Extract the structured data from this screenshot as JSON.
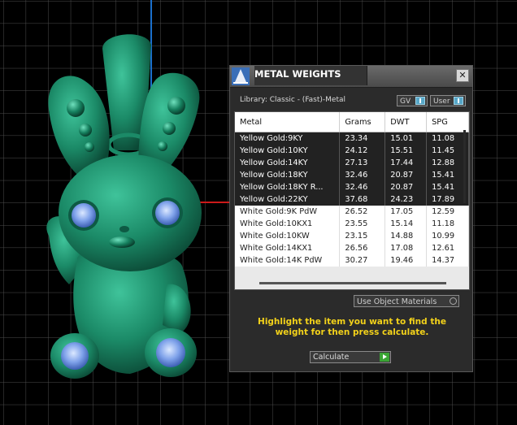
{
  "window": {
    "title": "METAL WEIGHTS",
    "close_glyph": "✕"
  },
  "library": {
    "label": "Library: Classic - (Fast)-Metal"
  },
  "toggles": {
    "gv_label": "GV",
    "user_label": "User"
  },
  "table": {
    "headers": [
      "Metal",
      "Grams",
      "DWT",
      "SPG"
    ],
    "rows": [
      {
        "metal": "Yellow Gold:9KY",
        "grams": "23.34",
        "dwt": "15.01",
        "spg": "11.08"
      },
      {
        "metal": "Yellow Gold:10KY",
        "grams": "24.12",
        "dwt": "15.51",
        "spg": "11.45"
      },
      {
        "metal": "Yellow Gold:14KY",
        "grams": "27.13",
        "dwt": "17.44",
        "spg": "12.88"
      },
      {
        "metal": "Yellow Gold:18KY",
        "grams": "32.46",
        "dwt": "20.87",
        "spg": "15.41"
      },
      {
        "metal": "Yellow Gold:18KY R...",
        "grams": "32.46",
        "dwt": "20.87",
        "spg": "15.41"
      },
      {
        "metal": "Yellow Gold:22KY",
        "grams": "37.68",
        "dwt": "24.23",
        "spg": "17.89"
      },
      {
        "metal": "White Gold:9K PdW",
        "grams": "26.52",
        "dwt": "17.05",
        "spg": "12.59"
      },
      {
        "metal": "White Gold:10KX1",
        "grams": "23.55",
        "dwt": "15.14",
        "spg": "11.18"
      },
      {
        "metal": "White Gold:10KW",
        "grams": "23.15",
        "dwt": "14.88",
        "spg": "10.99"
      },
      {
        "metal": "White Gold:14KX1",
        "grams": "26.56",
        "dwt": "17.08",
        "spg": "12.61"
      },
      {
        "metal": "White Gold:14K PdW",
        "grams": "30.27",
        "dwt": "19.46",
        "spg": "14.37"
      }
    ],
    "selected_rows": [
      0,
      1,
      2,
      3,
      4,
      5
    ]
  },
  "options": {
    "use_object_materials_label": "Use Object Materials"
  },
  "hint": {
    "text": "Highlight the item you want to find the weight for then press calculate."
  },
  "actions": {
    "calculate_label": "Calculate"
  },
  "colors": {
    "model": "#1f8a6a",
    "gem": "#6f93e0",
    "hint_text": "#f3d21a",
    "axis_x": "#cc1a1a",
    "axis_y": "#1a6fcc"
  },
  "icons": {
    "title_logo": "wizard-hat-logo",
    "close": "close-icon",
    "calculate": "play-arrow-icon"
  }
}
